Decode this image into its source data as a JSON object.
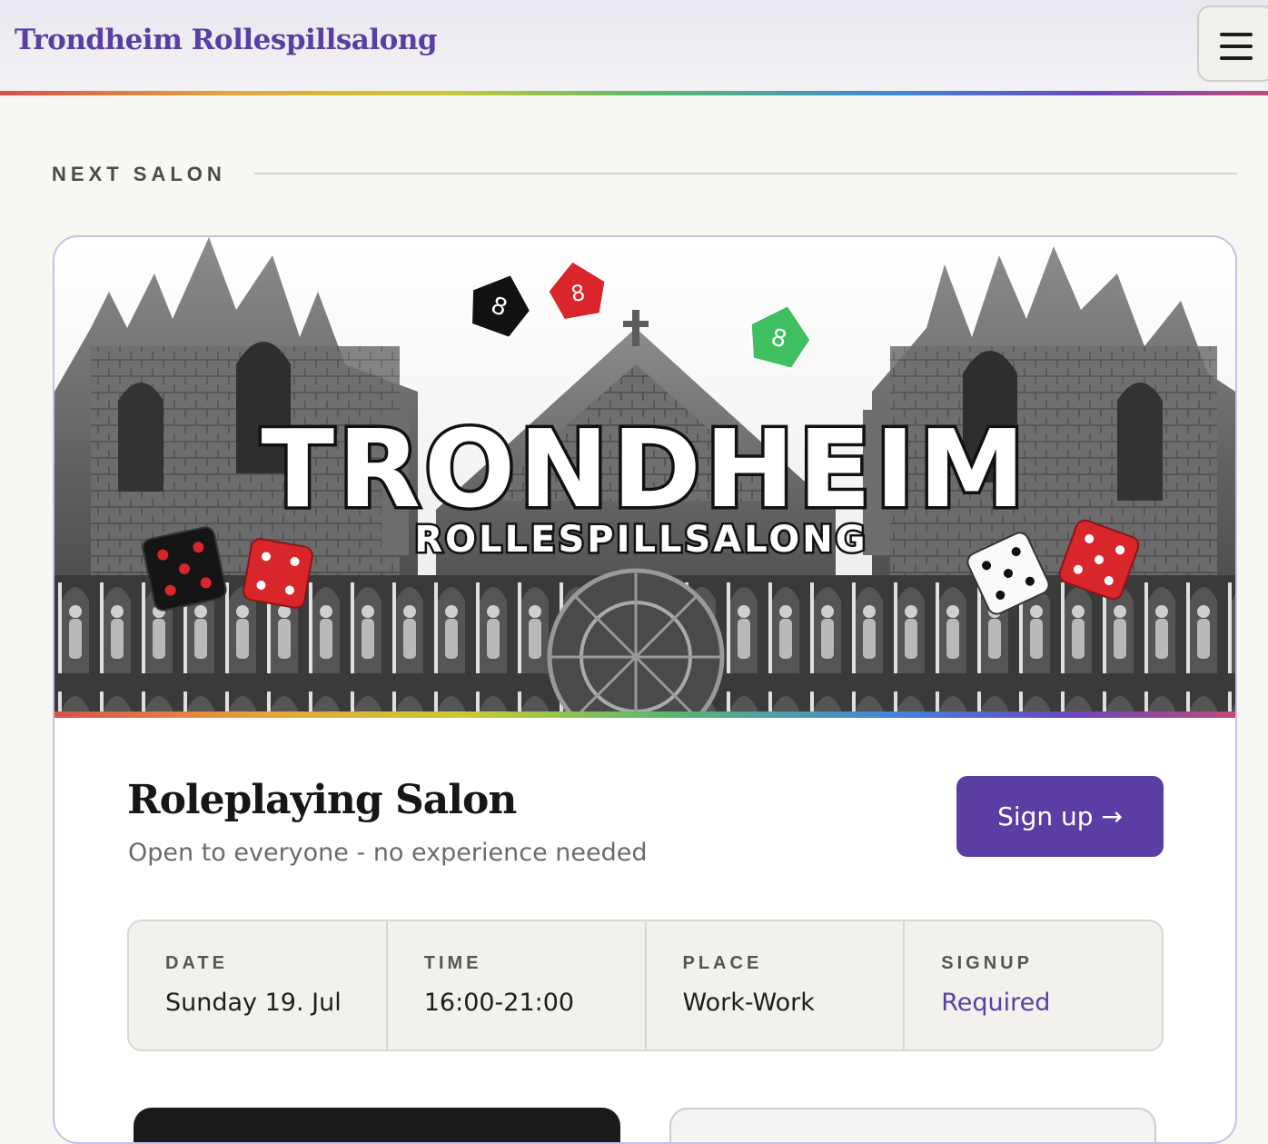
{
  "header": {
    "site_title": "Trondheim Rollespillsalong",
    "menu_icon": "hamburger-menu-icon",
    "accent_color": "#5b3ea3"
  },
  "section": {
    "heading": "NEXT SALON"
  },
  "event": {
    "banner": {
      "title_text": "TRONDHEIM",
      "subtitle_text": "ROLLESPILLSALONG",
      "die_glyph": "8"
    },
    "title": "Roleplaying Salon",
    "subtitle": "Open to everyone - no experience needed",
    "signup_button": "Sign up →",
    "details": [
      {
        "label": "DATE",
        "value": "Sunday 19. Jul"
      },
      {
        "label": "TIME",
        "value": "16:00-21:00"
      },
      {
        "label": "PLACE",
        "value": "Work-Work"
      },
      {
        "label": "SIGNUP",
        "value": "Required"
      }
    ]
  }
}
